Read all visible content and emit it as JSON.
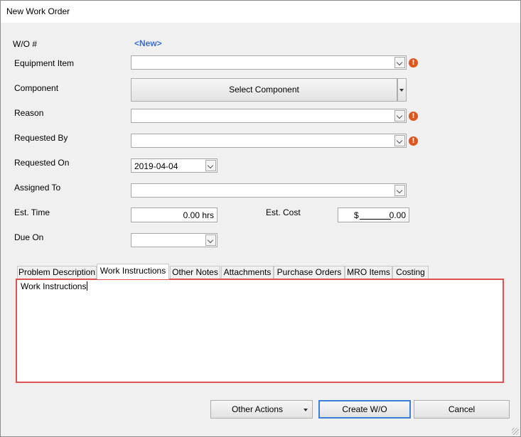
{
  "window": {
    "title": "New Work Order"
  },
  "form": {
    "wo_label": "W/O #",
    "wo_value": "<New>",
    "equipment_label": "Equipment Item",
    "component_label": "Component",
    "component_button": "Select Component",
    "reason_label": "Reason",
    "requested_by_label": "Requested By",
    "requested_on_label": "Requested On",
    "requested_on_value": "2019-04-04",
    "assigned_to_label": "Assigned To",
    "est_time_label": "Est. Time",
    "est_time_value": "0.00 hrs",
    "est_cost_label": "Est. Cost",
    "est_cost_currency": "$",
    "est_cost_value": "0.00",
    "due_on_label": "Due On",
    "required_icon": "exclamation-icon"
  },
  "tabs": [
    {
      "label": "Problem Description"
    },
    {
      "label": "Work Instructions",
      "active": true
    },
    {
      "label": "Other Notes"
    },
    {
      "label": "Attachments"
    },
    {
      "label": "Purchase Orders"
    },
    {
      "label": "MRO Items"
    },
    {
      "label": "Costing"
    }
  ],
  "panel": {
    "text": "Work Instructions"
  },
  "actions": {
    "other_actions": "Other Actions",
    "create": "Create W/O",
    "cancel": "Cancel"
  },
  "colors": {
    "highlight_border": "#e05252",
    "link": "#3a6fd1",
    "warning": "#e0541d"
  }
}
